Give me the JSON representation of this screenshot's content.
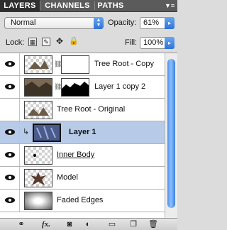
{
  "tabs": [
    {
      "label": "LAYERS",
      "active": true
    },
    {
      "label": "CHANNELS",
      "active": false
    },
    {
      "label": "PATHS",
      "active": false
    }
  ],
  "options": {
    "blend_mode": "Normal",
    "opacity_label": "Opacity:",
    "opacity_value": "61%",
    "lock_label": "Lock:",
    "fill_label": "Fill:",
    "fill_value": "100%"
  },
  "layers": [
    {
      "name": "Tree Root - Copy",
      "visible": true,
      "has_mask": true,
      "style": "normal",
      "selected": false
    },
    {
      "name": "Layer 1 copy 2",
      "visible": true,
      "has_mask": true,
      "style": "normal",
      "selected": false
    },
    {
      "name": "Tree Root - Original",
      "visible": false,
      "has_mask": false,
      "style": "normal",
      "selected": false
    },
    {
      "name": "Layer 1",
      "visible": true,
      "has_mask": false,
      "style": "bold",
      "selected": true,
      "clipped": true
    },
    {
      "name": "Inner Body",
      "visible": true,
      "has_mask": false,
      "style": "underline",
      "selected": false
    },
    {
      "name": "Model",
      "visible": true,
      "has_mask": false,
      "style": "normal",
      "selected": false
    },
    {
      "name": "Faded Edges",
      "visible": true,
      "has_mask": false,
      "style": "normal",
      "selected": false
    }
  ],
  "colors": {
    "tab_bar": "#5b5b5b",
    "selected_row": "#b7cbe9",
    "accent_blue": "#2d73d9"
  },
  "icons": {
    "bottom_bar": [
      "link-layers-icon",
      "fx-icon",
      "add-mask-icon",
      "adjustment-layer-icon",
      "new-group-icon",
      "new-layer-icon",
      "trash-icon"
    ]
  }
}
